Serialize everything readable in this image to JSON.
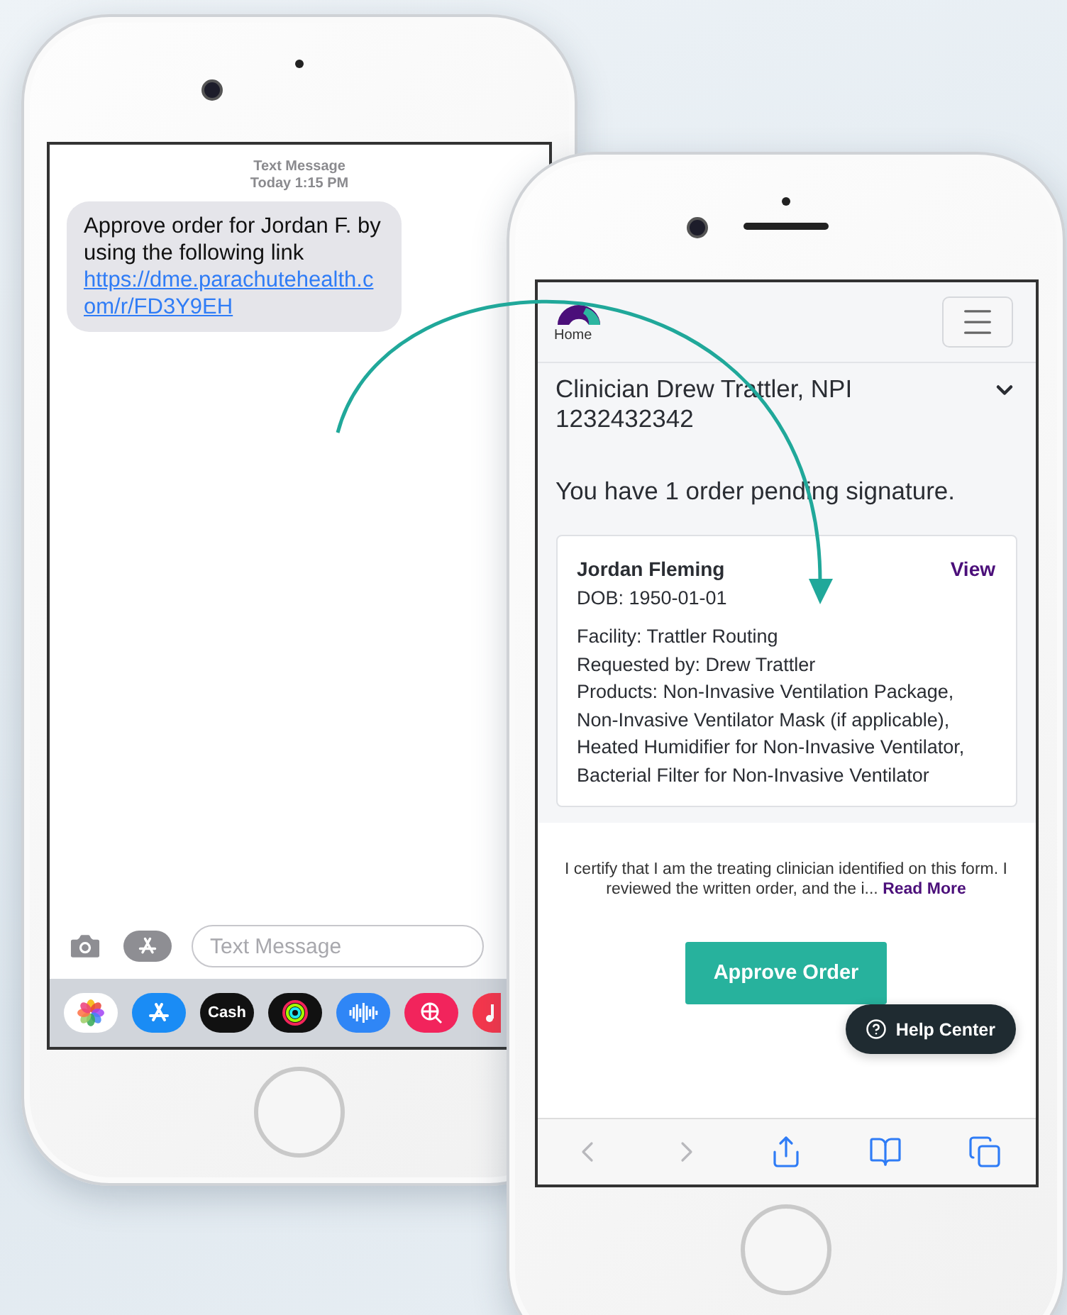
{
  "messages_phone": {
    "header": {
      "title": "Text Message",
      "time": "Today 1:15 PM"
    },
    "message": {
      "text": "Approve order for Jordan F. by using the following link ",
      "link": "https://dme.parachutehealth.com/r/FD3Y9EH"
    },
    "input": {
      "placeholder": "Text Message"
    },
    "app_drawer": [
      {
        "kind": "photos"
      },
      {
        "kind": "app-store"
      },
      {
        "kind": "cash",
        "label": "Cash"
      },
      {
        "kind": "activity"
      },
      {
        "kind": "sound"
      },
      {
        "kind": "globe-search"
      },
      {
        "kind": "music"
      }
    ]
  },
  "browser_phone": {
    "nav": {
      "home_label": "Home"
    },
    "clinician": {
      "text": "Clinician Drew Trattler, NPI 1232432342",
      "expanded": false
    },
    "pending": "You have 1 order pending signature.",
    "order_card": {
      "patient": "Jordan Fleming",
      "action": "View",
      "dob": "DOB: 1950-01-01",
      "details": [
        "Facility: Trattler Routing",
        "Requested by: Drew Trattler",
        "Products: Non-Invasive Ventilation Package, Non-Invasive Ventilator Mask (if applicable), Heated Humidifier for Non-Invasive Ventilator, Bacterial Filter for Non-Invasive Ventilator"
      ]
    },
    "certify": {
      "text": "I certify that I am the treating clinician identified on this form. I reviewed the written order, and the i... ",
      "link": "Read More"
    },
    "approve_button": "Approve Order",
    "help_button": "Help Center",
    "toolbar": [
      {
        "kind": "back",
        "disabled": true
      },
      {
        "kind": "forward",
        "disabled": true
      },
      {
        "kind": "share",
        "disabled": false
      },
      {
        "kind": "bookmarks",
        "disabled": false
      },
      {
        "kind": "tabs",
        "disabled": false
      }
    ]
  }
}
